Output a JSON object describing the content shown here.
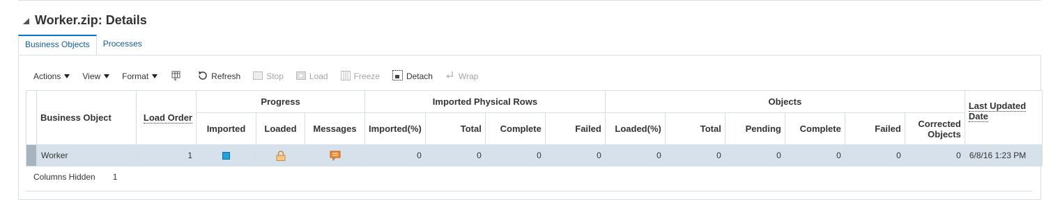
{
  "header": {
    "title": "Worker.zip: Details"
  },
  "tabs": [
    {
      "label": "Business Objects"
    },
    {
      "label": "Processes"
    }
  ],
  "toolbar": {
    "actions": "Actions",
    "view": "View",
    "format": "Format",
    "refresh": "Refresh",
    "stop": "Stop",
    "load": "Load",
    "freeze": "Freeze",
    "detach": "Detach",
    "wrap": "Wrap"
  },
  "table": {
    "groups": {
      "business_object": "Business Object",
      "load_order": "Load Order",
      "progress": "Progress",
      "imported_physical_rows": "Imported Physical Rows",
      "objects": "Objects",
      "last_updated": "Last Updated Date"
    },
    "subheaders": {
      "imported": "Imported",
      "loaded": "Loaded",
      "messages": "Messages",
      "imported_pct": "Imported(%)",
      "rows_total": "Total",
      "rows_complete": "Complete",
      "rows_failed": "Failed",
      "loaded_pct": "Loaded(%)",
      "obj_total": "Total",
      "obj_pending": "Pending",
      "obj_complete": "Complete",
      "obj_failed": "Failed",
      "corrected_line1": "Corrected",
      "corrected_line2": "Objects"
    },
    "rows": [
      {
        "business_object": "Worker",
        "load_order": "1",
        "imported_icon": "square-status-icon",
        "loaded_icon": "lock-icon",
        "messages_icon": "message-bubble-icon",
        "imported_pct": "0",
        "rows_total": "0",
        "rows_complete": "0",
        "rows_failed": "0",
        "loaded_pct": "0",
        "obj_total": "0",
        "obj_pending": "0",
        "obj_complete": "0",
        "obj_failed": "0",
        "corrected": "0",
        "last_updated": "6/8/16 1:23 PM"
      }
    ]
  },
  "footer": {
    "columns_hidden_label": "Columns Hidden",
    "columns_hidden_value": "1"
  },
  "colors": {
    "accent": "#0572ce",
    "selected_row": "#d6e1ec",
    "border": "#d6dfe6"
  }
}
